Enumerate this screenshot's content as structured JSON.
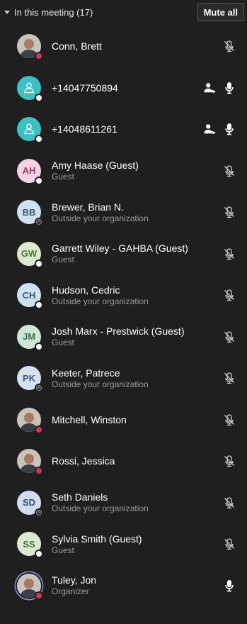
{
  "header": {
    "title": "In this meeting (17)",
    "mute_all": "Mute all"
  },
  "participants": [
    {
      "name": "Conn, Brett",
      "sub": "",
      "avatar": {
        "type": "photo",
        "initials": ""
      },
      "presence": "red",
      "mic": "muted"
    },
    {
      "name": "+14047750894",
      "sub": "",
      "avatar": {
        "type": "phone",
        "initials": ""
      },
      "presence": "white",
      "mic": "on",
      "extra": "phone-user-icon"
    },
    {
      "name": "+14048611261",
      "sub": "",
      "avatar": {
        "type": "phone",
        "initials": ""
      },
      "presence": "white",
      "mic": "on",
      "extra": "phone-user-icon"
    },
    {
      "name": "Amy Haase (Guest)",
      "sub": "Guest",
      "avatar": {
        "type": "initials",
        "initials": "AH",
        "bg": "#f4d3e4",
        "fg": "#a83a68"
      },
      "presence": "white",
      "mic": "muted"
    },
    {
      "name": "Brewer, Brian N.",
      "sub": "Outside your organization",
      "avatar": {
        "type": "initials",
        "initials": "BB",
        "bg": "#cfe0ef",
        "fg": "#3a5c7d"
      },
      "presence": "gray",
      "mic": "muted"
    },
    {
      "name": "Garrett Wiley - GAHBA (Guest)",
      "sub": "Guest",
      "avatar": {
        "type": "initials",
        "initials": "GW",
        "bg": "#dde9cc",
        "fg": "#55743a"
      },
      "presence": "white",
      "mic": "muted"
    },
    {
      "name": "Hudson, Cedric",
      "sub": "Outside your organization",
      "avatar": {
        "type": "initials",
        "initials": "CH",
        "bg": "#cfe0ef",
        "fg": "#3a5c7d"
      },
      "presence": "white",
      "mic": "muted"
    },
    {
      "name": "Josh Marx - Prestwick (Guest)",
      "sub": "Guest",
      "avatar": {
        "type": "initials",
        "initials": "JM",
        "bg": "#cde7d6",
        "fg": "#3b7253"
      },
      "presence": "white",
      "mic": "muted"
    },
    {
      "name": "Keeter, Patrece",
      "sub": "Outside your organization",
      "avatar": {
        "type": "initials",
        "initials": "PK",
        "bg": "#d6e2f1",
        "fg": "#3b5679"
      },
      "presence": "gray",
      "mic": "muted"
    },
    {
      "name": "Mitchell, Winston",
      "sub": "",
      "avatar": {
        "type": "photo",
        "initials": ""
      },
      "presence": "red",
      "mic": "muted"
    },
    {
      "name": "Rossi, Jessica",
      "sub": "",
      "avatar": {
        "type": "photo",
        "initials": ""
      },
      "presence": "red",
      "mic": "muted"
    },
    {
      "name": "Seth Daniels",
      "sub": "Outside your organization",
      "avatar": {
        "type": "initials",
        "initials": "SD",
        "bg": "#d3dced",
        "fg": "#344f7a"
      },
      "presence": "gray",
      "mic": "muted"
    },
    {
      "name": "Sylvia Smith (Guest)",
      "sub": "Guest",
      "avatar": {
        "type": "initials",
        "initials": "SS",
        "bg": "#d9ead1",
        "fg": "#4b7433"
      },
      "presence": "white",
      "mic": "muted"
    },
    {
      "name": "Tuley, Jon",
      "sub": "Organizer",
      "avatar": {
        "type": "photo",
        "initials": "",
        "organizer": true
      },
      "presence": "red",
      "mic": "on"
    }
  ],
  "colors": {
    "background": "#1f1f1f",
    "presence_busy": "#d1345b",
    "phone_avatar": "#3bc1c3",
    "muted_text": "#9a9a9a"
  }
}
